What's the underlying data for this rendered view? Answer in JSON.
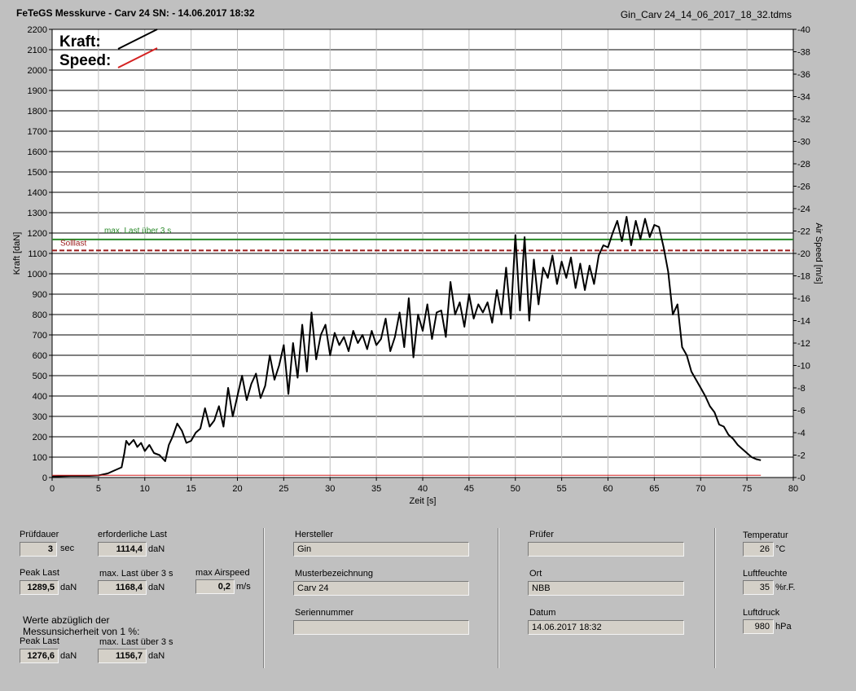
{
  "header": {
    "title": "FeTeGS Messkurve - Carv 24  SN:  - 14.06.2017 18:32",
    "filename": "Gin_Carv 24_14_06_2017_18_32.tdms"
  },
  "chart_data": {
    "type": "line",
    "xlabel": "Zeit [s]",
    "ylabel": "Kraft [daN]",
    "y2label": "Air Speed [m/s]",
    "xlim": [
      0,
      80
    ],
    "ylim": [
      0,
      2200
    ],
    "y2lim": [
      0,
      40
    ],
    "x_ticks": [
      0,
      5,
      10,
      15,
      20,
      25,
      30,
      35,
      40,
      45,
      50,
      55,
      60,
      65,
      70,
      75,
      80
    ],
    "y_ticks": [
      0,
      100,
      200,
      300,
      400,
      500,
      600,
      700,
      800,
      900,
      1000,
      1100,
      1200,
      1300,
      1400,
      1500,
      1600,
      1700,
      1800,
      1900,
      2000,
      2100,
      2200
    ],
    "y2_ticks": [
      0,
      2,
      4,
      6,
      8,
      10,
      12,
      14,
      16,
      18,
      20,
      22,
      24,
      26,
      28,
      30,
      32,
      34,
      36,
      38,
      40
    ],
    "grid": true,
    "legend": [
      {
        "name": "Kraft:",
        "color": "#000000"
      },
      {
        "name": "Speed:",
        "color": "#d42020"
      }
    ],
    "reference_lines": [
      {
        "label": "max. Last über  3 s",
        "y": 1168.4,
        "color": "#2a8a2a",
        "style": "solid"
      },
      {
        "label": "Solllast",
        "y": 1114.4,
        "color": "#9a1a1a",
        "style": "dashed"
      }
    ],
    "series": [
      {
        "name": "Kraft",
        "color": "#000000",
        "x": [
          0,
          2,
          4,
          5,
          6,
          6.5,
          7,
          7.5,
          7.8,
          8,
          8.3,
          8.8,
          9.2,
          9.6,
          10,
          10.5,
          11,
          11.6,
          12.2,
          12.6,
          13,
          13.5,
          14,
          14.5,
          15,
          15.5,
          16,
          16.5,
          17,
          17.5,
          18,
          18.5,
          19,
          19.5,
          20,
          20.5,
          21,
          21.5,
          22,
          22.5,
          23,
          23.5,
          24,
          24.5,
          25,
          25.5,
          26,
          26.5,
          27,
          27.5,
          28,
          28.5,
          29,
          29.5,
          30,
          30.5,
          31,
          31.5,
          32,
          32.5,
          33,
          33.5,
          34,
          34.5,
          35,
          35.5,
          36,
          36.5,
          37,
          37.5,
          38,
          38.5,
          39,
          39.5,
          40,
          40.5,
          41,
          41.5,
          42,
          42.5,
          43,
          43.5,
          44,
          44.5,
          45,
          45.5,
          46,
          46.5,
          47,
          47.5,
          48,
          48.5,
          49,
          49.5,
          50,
          50.5,
          51,
          51.5,
          52,
          52.5,
          53,
          53.5,
          54,
          54.5,
          55,
          55.5,
          56,
          56.5,
          57,
          57.5,
          58,
          58.5,
          59,
          59.5,
          60,
          60.5,
          61,
          61.5,
          62,
          62.5,
          63,
          63.5,
          64,
          64.5,
          65,
          65.5,
          66,
          66.5,
          67,
          67.5,
          68,
          68.5,
          69,
          69.5,
          70,
          70.5,
          71,
          71.5,
          72,
          72.5,
          73,
          73.5,
          74,
          74.5,
          75,
          75.5,
          76,
          76.5
        ],
        "values": [
          5,
          8,
          8,
          10,
          20,
          30,
          40,
          50,
          120,
          180,
          160,
          185,
          150,
          170,
          130,
          160,
          120,
          110,
          80,
          160,
          200,
          265,
          230,
          170,
          180,
          220,
          240,
          340,
          250,
          280,
          350,
          250,
          440,
          300,
          400,
          500,
          380,
          460,
          510,
          390,
          450,
          600,
          480,
          550,
          650,
          410,
          660,
          490,
          750,
          520,
          810,
          580,
          700,
          750,
          600,
          710,
          650,
          690,
          620,
          720,
          660,
          700,
          630,
          720,
          650,
          680,
          780,
          620,
          690,
          810,
          640,
          880,
          590,
          800,
          720,
          850,
          680,
          810,
          820,
          690,
          960,
          800,
          860,
          740,
          900,
          780,
          850,
          810,
          860,
          760,
          920,
          800,
          1030,
          780,
          1190,
          820,
          1180,
          770,
          1070,
          850,
          1030,
          980,
          1090,
          950,
          1060,
          980,
          1080,
          930,
          1050,
          920,
          1040,
          950,
          1090,
          1140,
          1130,
          1200,
          1260,
          1160,
          1280,
          1140,
          1260,
          1170,
          1270,
          1180,
          1240,
          1230,
          1130,
          1010,
          800,
          850,
          640,
          600,
          520,
          480,
          440,
          400,
          350,
          320,
          260,
          250,
          210,
          190,
          160,
          140,
          120,
          100,
          90,
          85
        ]
      },
      {
        "name": "Speed",
        "color": "#d42020",
        "x": [
          0,
          76.5
        ],
        "values": [
          0.2,
          0.2
        ]
      }
    ]
  },
  "panel": {
    "pruefdauer_label": "Prüfdauer",
    "pruefdauer_value": "3",
    "pruefdauer_unit": "sec",
    "erf_last_label": "erforderliche Last",
    "erf_last_value": "1114,4",
    "erf_last_unit": "daN",
    "peak_last_label": "Peak Last",
    "peak_last_value": "1289,5",
    "peak_last_unit": "daN",
    "max_last_label": "max. Last über  3 s",
    "max_last_value": "1168,4",
    "max_last_unit": "daN",
    "max_airspeed_label": "max Airspeed",
    "max_airspeed_value": "0,2",
    "max_airspeed_unit": "m/s",
    "werte_line1": "Werte abzüglich der",
    "werte_line2": "Messunsicherheit von 1  %:",
    "peak_last2_label": "Peak Last",
    "peak_last2_value": "1276,6",
    "peak_last2_unit": "daN",
    "max_last2_label": "max. Last über  3 s",
    "max_last2_value": "1156,7",
    "max_last2_unit": "daN",
    "hersteller_label": "Hersteller",
    "hersteller_value": "Gin",
    "muster_label": "Musterbezeichnung",
    "muster_value": "Carv 24",
    "serien_label": "Seriennummer",
    "serien_value": "",
    "pruefer_label": "Prüfer",
    "pruefer_value": "",
    "ort_label": "Ort",
    "ort_value": "NBB",
    "datum_label": "Datum",
    "datum_value": "14.06.2017 18:32",
    "temp_label": "Temperatur",
    "temp_value": "26",
    "temp_unit": "°C",
    "feuchte_label": "Luftfeuchte",
    "feuchte_value": "35",
    "feuchte_unit": "%r.F.",
    "druck_label": "Luftdruck",
    "druck_value": "980",
    "druck_unit": "hPa"
  }
}
